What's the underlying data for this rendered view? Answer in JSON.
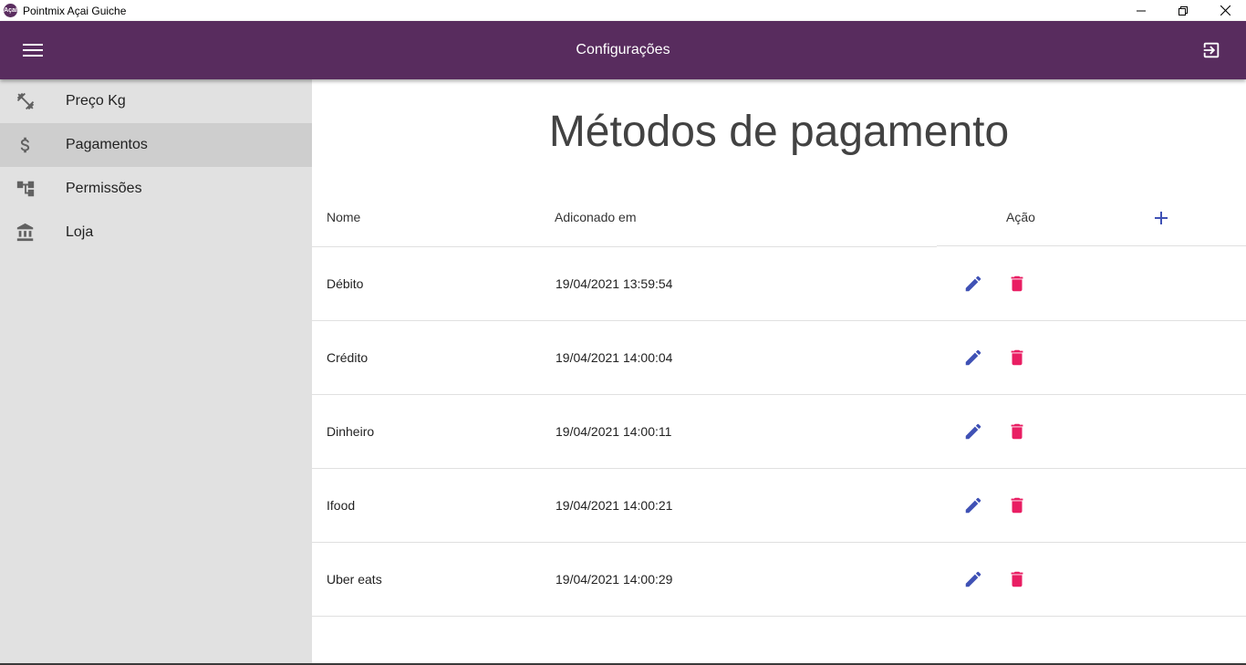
{
  "window": {
    "title": "Pointmix Açai Guiche",
    "app_icon_text": "Açaí",
    "controls": [
      "minimize-icon",
      "restore-icon",
      "close-icon"
    ]
  },
  "appbar": {
    "title": "Configurações",
    "menu_icon": "menu-icon",
    "logout_icon": "logout-icon",
    "background": "#582c5e"
  },
  "sidebar": {
    "items": [
      {
        "label": "Preço Kg",
        "icon": "weight-icon",
        "active": false
      },
      {
        "label": "Pagamentos",
        "icon": "dollar-icon",
        "active": true
      },
      {
        "label": "Permissões",
        "icon": "hierarchy-icon",
        "active": false
      },
      {
        "label": "Loja",
        "icon": "bank-icon",
        "active": false
      }
    ]
  },
  "main": {
    "title": "Métodos de pagamento",
    "table": {
      "headers": {
        "name": "Nome",
        "added": "Adiconado em",
        "action": "Ação"
      },
      "add_icon": "plus-icon",
      "rows": [
        {
          "name": "Débito",
          "added": "19/04/2021 13:59:54"
        },
        {
          "name": "Crédito",
          "added": "19/04/2021 14:00:04"
        },
        {
          "name": "Dinheiro",
          "added": "19/04/2021 14:00:11"
        },
        {
          "name": "Ifood",
          "added": "19/04/2021 14:00:21"
        },
        {
          "name": "Uber eats",
          "added": "19/04/2021 14:00:29"
        }
      ]
    }
  },
  "colors": {
    "edit": "#3f51b5",
    "delete": "#e91e63",
    "sidebar_bg": "#e1e1e1",
    "sidebar_active": "#cecece"
  }
}
